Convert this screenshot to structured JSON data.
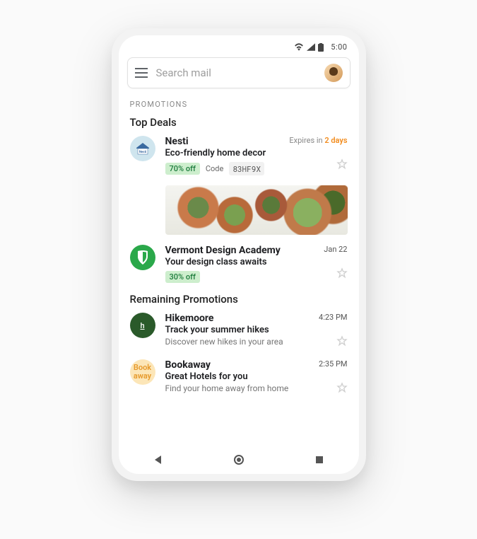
{
  "status": {
    "time": "5:00"
  },
  "search": {
    "placeholder": "Search mail"
  },
  "category_label": "PROMOTIONS",
  "sections": {
    "top_deals": {
      "title": "Top Deals",
      "items": [
        {
          "sender": "Nesti",
          "subject": "Eco-friendly home decor",
          "discount": "70% off",
          "code_label": "Code",
          "code": "83HF9X",
          "expire_prefix": "Expires in ",
          "expire_time": "2 days"
        },
        {
          "sender": "Vermont Design Academy",
          "subject": "Your design class awaits",
          "discount": "30% off",
          "date": "Jan 22"
        }
      ]
    },
    "remaining": {
      "title": "Remaining Promotions",
      "items": [
        {
          "sender": "Hikemoore",
          "subject": "Track your summer hikes",
          "snippet": "Discover new hikes in your area",
          "time": "4:23 PM"
        },
        {
          "sender": "Bookaway",
          "subject": "Great Hotels for you",
          "snippet": "Find your home away from home",
          "time": "2:35 PM"
        }
      ]
    }
  },
  "logos": {
    "hike_letter": "h",
    "book_line1": "Book",
    "book_line2": "away"
  }
}
